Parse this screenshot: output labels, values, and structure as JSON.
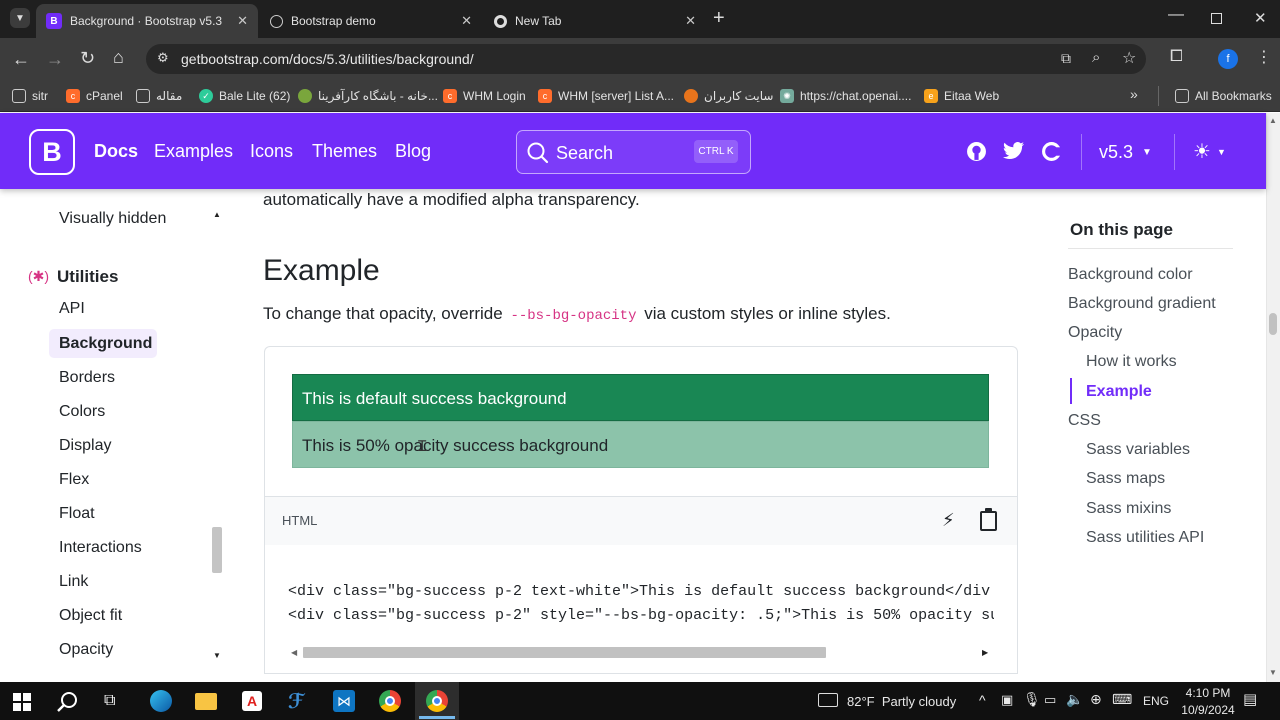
{
  "browser": {
    "tabs": [
      {
        "title": "Background · Bootstrap v5.3",
        "favicon": "B",
        "active": true
      },
      {
        "title": "Bootstrap demo",
        "favicon": "globe",
        "active": false
      },
      {
        "title": "New Tab",
        "favicon": "chrome",
        "active": false
      }
    ],
    "url": "getbootstrap.com/docs/5.3/utilities/background/",
    "bookmarks": [
      "sitr",
      "cPanel",
      "مقاله",
      "Bale Lite (62)",
      "خانه - باشگاه کارآفرینا...",
      "WHM Login",
      "WHM [server] List A...",
      "سایت کاربران",
      "https://chat.openai....",
      "Eitaa Web"
    ],
    "all_bookmarks": "All Bookmarks",
    "profile_initial": "f"
  },
  "navbar": {
    "brand": "B",
    "links": [
      "Docs",
      "Examples",
      "Icons",
      "Themes",
      "Blog"
    ],
    "search_placeholder": "Search",
    "search_shortcut": "CTRL K",
    "version": "v5.3"
  },
  "sidebar": {
    "items_top": [
      "Visually hidden"
    ],
    "section": "Utilities",
    "items": [
      "API",
      "Background",
      "Borders",
      "Colors",
      "Display",
      "Flex",
      "Float",
      "Interactions",
      "Link",
      "Object fit",
      "Opacity"
    ],
    "active": "Background"
  },
  "main": {
    "intro_tail": "automatically have a modified alpha transparency.",
    "heading": "Example",
    "para_before": "To change that opacity, override",
    "para_code": "--bs-bg-opacity",
    "para_after": "via custom styles or inline styles.",
    "demo_default": "This is default success background",
    "demo_half": "This is 50% opacity success background",
    "code_lang": "HTML",
    "code_lines": [
      "<div class=\"bg-success p-2 text-white\">This is default success background</div",
      "<div class=\"bg-success p-2\" style=\"--bs-bg-opacity: .5;\">This is 50% opacity su"
    ]
  },
  "toc": {
    "title": "On this page",
    "items": [
      "Background color",
      "Background gradient",
      "Opacity",
      "How it works",
      "Example",
      "CSS",
      "Sass variables",
      "Sass maps",
      "Sass mixins",
      "Sass utilities API"
    ],
    "active": "Example"
  },
  "taskbar": {
    "weather": "82°F  Partly cloudy",
    "lang": "ENG",
    "time": "4:10 PM",
    "date": "10/9/2024"
  },
  "colors": {
    "bs_purple": "#712cf9",
    "success": "#198754",
    "success_half": "#8cc3aa"
  }
}
